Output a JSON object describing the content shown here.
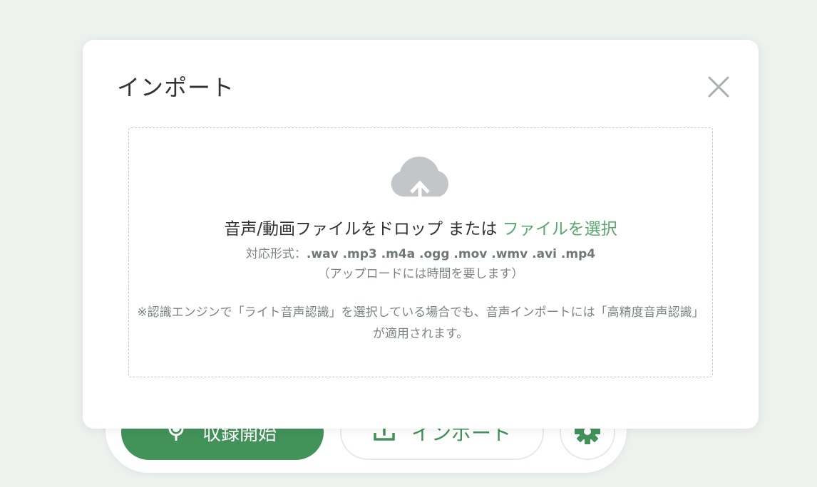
{
  "toolbar": {
    "record_label": "収録開始",
    "import_label": "インポート",
    "accent_color": "#43925a"
  },
  "modal": {
    "title": "インポート",
    "drop_text": "音声/動画ファイルをドロップ または ",
    "select_link": "ファイルを選択",
    "formats_prefix": "対応形式：",
    "formats_list": ".wav .mp3 .m4a .ogg .mov .wmv .avi .mp4",
    "upload_note": "（アップロードには時間を要します）",
    "engine_note": "※認識エンジンで「ライト音声認識」を選択している場合でも、音声インポートには「高精度音声認識」が適用されます。"
  },
  "icons": {
    "close": "close-icon",
    "cloud": "cloud-upload-icon",
    "mic": "microphone-icon",
    "upload": "upload-icon",
    "gear": "gear-icon"
  }
}
